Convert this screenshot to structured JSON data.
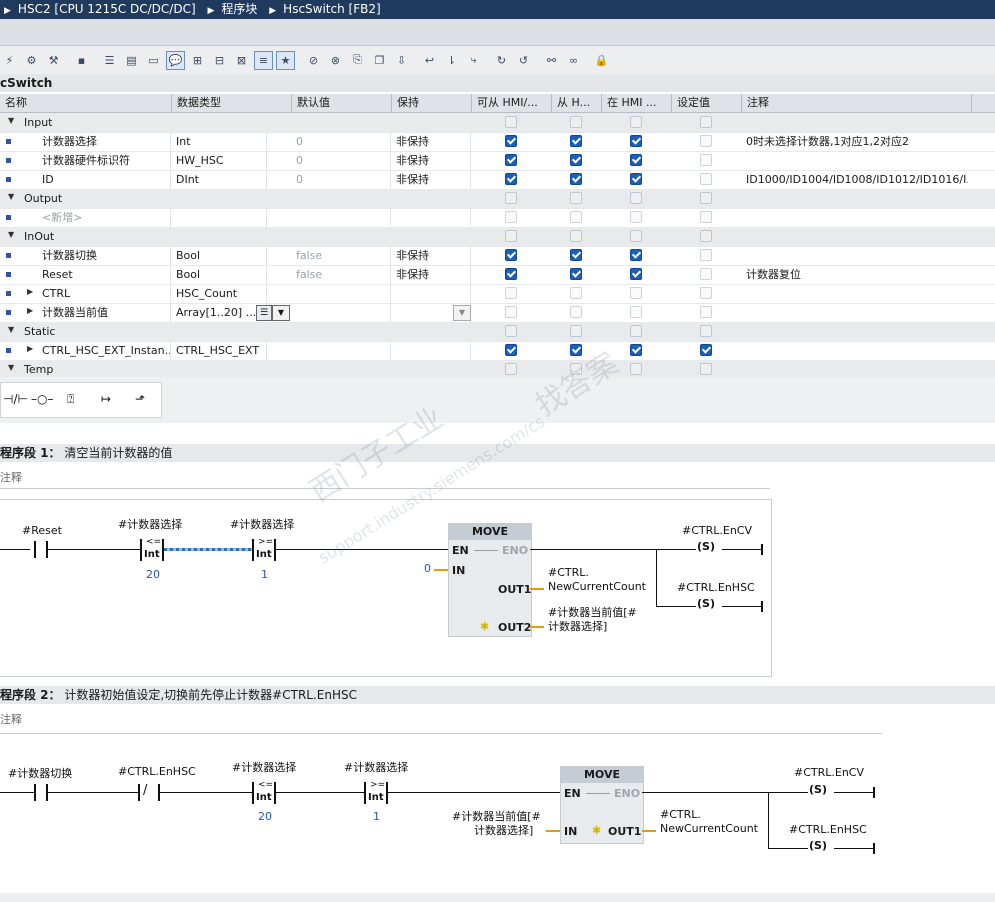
{
  "breadcrumb": {
    "device": "HSC2 [CPU 1215C DC/DC/DC]",
    "folder": "程序块",
    "block": "HscSwitch [FB2]"
  },
  "block_title": "cSwitch",
  "table": {
    "headers": {
      "name": "名称",
      "datatype": "数据类型",
      "default": "默认值",
      "retain": "保持",
      "hmi_access": "可从 HMI/...",
      "hmi_write": "从 H...",
      "hmi_visible": "在 HMI ...",
      "setpoint": "设定值",
      "comment": "注释"
    },
    "rows": [
      {
        "kind": "section",
        "name": "Input"
      },
      {
        "kind": "var",
        "name": "计数器选择",
        "type": "Int",
        "default": "0",
        "retain": "非保持",
        "c1": true,
        "c2": true,
        "c3": true,
        "sp": false,
        "comment": "0时未选择计数器,1对应1,2对应2"
      },
      {
        "kind": "var",
        "name": "计数器硬件标识符",
        "type": "HW_HSC",
        "default": "0",
        "retain": "非保持",
        "c1": true,
        "c2": true,
        "c3": true,
        "sp": false,
        "comment": ""
      },
      {
        "kind": "var",
        "name": "ID",
        "type": "DInt",
        "default": "0",
        "retain": "非保持",
        "c1": true,
        "c2": true,
        "c3": true,
        "sp": false,
        "comment": "ID1000/ID1004/ID1008/ID1012/ID1016/I..."
      },
      {
        "kind": "section",
        "name": "Output"
      },
      {
        "kind": "new",
        "name": "<新增>"
      },
      {
        "kind": "section",
        "name": "InOut"
      },
      {
        "kind": "var",
        "name": "计数器切换",
        "type": "Bool",
        "default": "false",
        "retain": "非保持",
        "c1": true,
        "c2": true,
        "c3": true,
        "sp": false,
        "comment": ""
      },
      {
        "kind": "var",
        "name": "Reset",
        "type": "Bool",
        "default": "false",
        "retain": "非保持",
        "c1": true,
        "c2": true,
        "c3": true,
        "sp": false,
        "comment": "计数器复位"
      },
      {
        "kind": "struct",
        "name": "CTRL",
        "type": "HSC_Count",
        "default": "",
        "retain": "",
        "c1": false,
        "c2": false,
        "c3": false,
        "sp": false,
        "comment": ""
      },
      {
        "kind": "struct",
        "name": "计数器当前值",
        "type": "Array[1..20] ...",
        "default": "",
        "retain": "",
        "c1": false,
        "c2": false,
        "c3": false,
        "sp": false,
        "comment": ""
      },
      {
        "kind": "section",
        "name": "Static"
      },
      {
        "kind": "struct",
        "name": "CTRL_HSC_EXT_Instan...",
        "type": "CTRL_HSC_EXT",
        "default": "",
        "retain": "",
        "c1": true,
        "c2": true,
        "c3": true,
        "sp": true,
        "comment": ""
      },
      {
        "kind": "section",
        "name": "Temp"
      }
    ]
  },
  "networks": [
    {
      "label": "程序段 1：",
      "title": "清空当前计数器的值",
      "comment": "注释",
      "contact1": "#Reset",
      "cmp1": {
        "tag": "#计数器选择",
        "op": "<=",
        "type": "Int",
        "value": "20"
      },
      "cmp2": {
        "tag": "#计数器选择",
        "op": ">=",
        "type": "Int",
        "value": "1"
      },
      "move": {
        "title": "MOVE",
        "en": "EN",
        "eno": "ENO",
        "in": "IN",
        "in_val": "0",
        "out1": "OUT1",
        "out1_val1": "#CTRL.",
        "out1_val2": "NewCurrentCount",
        "out2": "OUT2",
        "out2_val1": "#计数器当前值[#",
        "out2_val2": "计数器选择]"
      },
      "coil1": {
        "tag": "#CTRL.EnCV",
        "sym": "S"
      },
      "coil2": {
        "tag": "#CTRL.EnHSC",
        "sym": "S"
      }
    },
    {
      "label": "程序段 2：",
      "title": "计数器初始值设定,切换前先停止计数器#CTRL.EnHSC",
      "comment": "注释",
      "contact1": "#计数器切换",
      "contact2": "#CTRL.EnHSC",
      "cmp1": {
        "tag": "#计数器选择",
        "op": "<=",
        "type": "Int",
        "value": "20"
      },
      "cmp2": {
        "tag": "#计数器选择",
        "op": ">=",
        "type": "Int",
        "value": "1"
      },
      "move": {
        "title": "MOVE",
        "en": "EN",
        "eno": "ENO",
        "in": "IN",
        "in_val1": "#计数器当前值[#",
        "in_val2": "计数器选择]",
        "out1": "OUT1",
        "out1_val1": "#CTRL.",
        "out1_val2": "NewCurrentCount"
      },
      "coil1": {
        "tag": "#CTRL.EnCV",
        "sym": "S"
      },
      "coil2": {
        "tag": "#CTRL.EnHSC",
        "sym": "S"
      }
    }
  ],
  "watermark": {
    "line1": "西门子工业",
    "line2": "support.industry.siemens.com/cs",
    "line3": "找答案"
  },
  "icons": [
    "insert-row-icon",
    "delete-row-icon",
    "block-icon",
    "monitor-icon",
    "compile-icon",
    "network-icon",
    "comment-icon",
    "settings-icon"
  ]
}
